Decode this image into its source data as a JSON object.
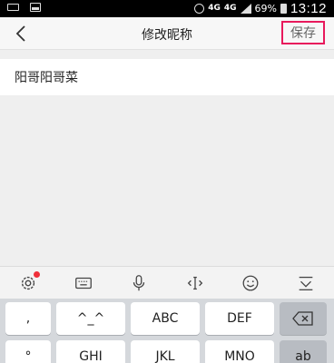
{
  "status_bar": {
    "network_left": "4G",
    "network_right": "4G",
    "battery": "69%",
    "time": "13:12",
    "icons": [
      "keyboard-icon",
      "image-icon",
      "alarm-icon",
      "signal-icon",
      "battery-icon"
    ]
  },
  "header": {
    "title": "修改昵称",
    "save_label": "保存",
    "back_icon": "chevron-left-icon",
    "accent_color": "#e8195c"
  },
  "form": {
    "nickname_value": "阳哥阳哥菜"
  },
  "keyboard_toolbar": {
    "items": [
      "settings-icon",
      "keyboard-icon",
      "microphone-icon",
      "cursor-move-icon",
      "emoji-icon",
      "collapse-keyboard-icon"
    ]
  },
  "keyboard": {
    "row1": [
      ",",
      "^_^",
      "ABC",
      "DEF"
    ],
    "row2": [
      "°",
      "GHI",
      "JKL",
      "MNO",
      "ab"
    ],
    "delete_icon": "backspace-icon"
  }
}
